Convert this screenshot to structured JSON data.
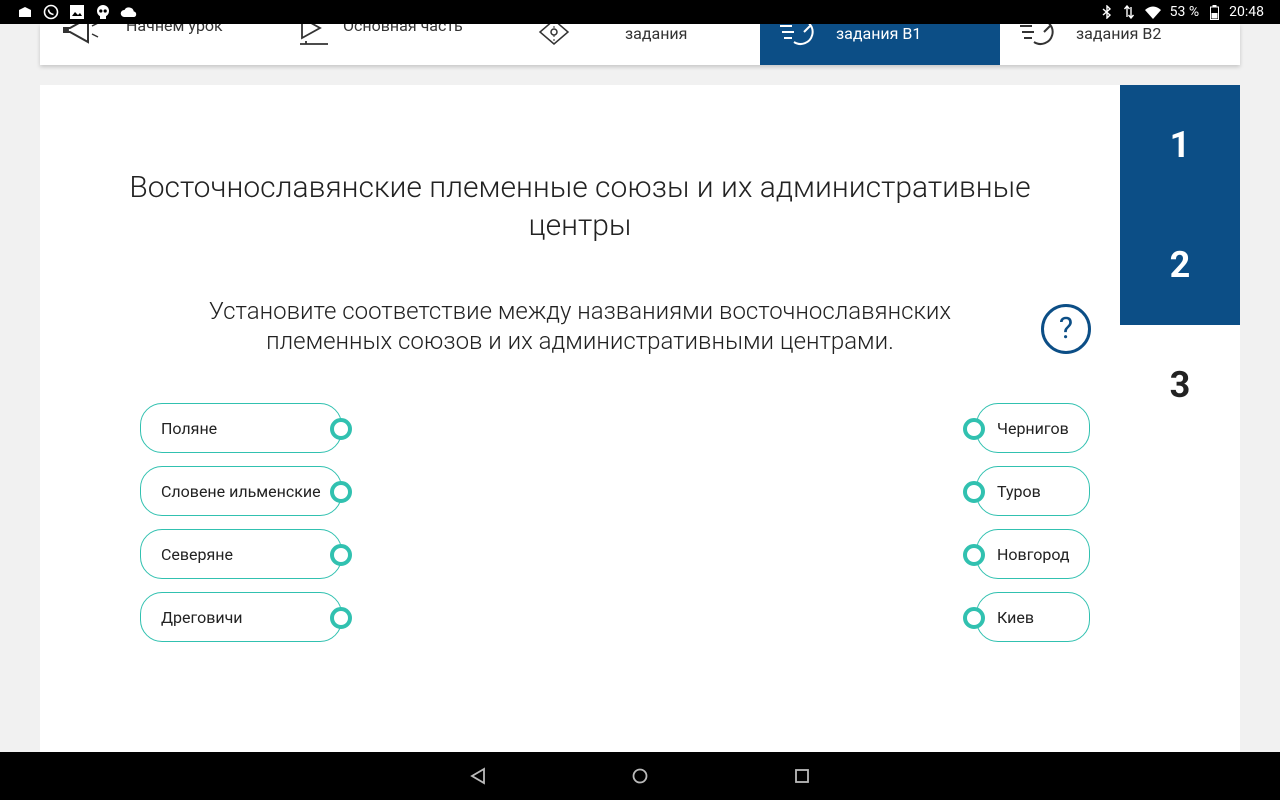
{
  "status_bar": {
    "battery": "53 %",
    "time": "20:48",
    "left_icons": [
      "notification-icon",
      "whatsapp-icon",
      "image-icon",
      "skull-icon",
      "cloud-icon"
    ],
    "right_icons": [
      "bluetooth-icon",
      "data-icon",
      "wifi-icon",
      "battery-icon"
    ]
  },
  "tabs": [
    {
      "label": "Начнем урок",
      "icon": "megaphone-icon",
      "active": false
    },
    {
      "label": "Основная часть",
      "icon": "pen-icon",
      "active": false
    },
    {
      "label": "задания",
      "icon": "target-icon",
      "active": false
    },
    {
      "label": "задания В1",
      "icon": "speed-icon",
      "active": true
    },
    {
      "label": "задания В2",
      "icon": "speed-icon",
      "active": false
    }
  ],
  "main": {
    "title": "Восточнославянские племенные союзы и их административные центры",
    "instruction": "Установите соответствие между названиями восточнославянских племенных союзов и их административными центрами.",
    "help_symbol": "?"
  },
  "question_nav": [
    {
      "label": "1",
      "state": "done"
    },
    {
      "label": "2",
      "state": "done"
    },
    {
      "label": "3",
      "state": "current"
    }
  ],
  "left_items": [
    "Поляне",
    "Словене ильменские",
    "Северяне",
    "Дреговичи"
  ],
  "right_items": [
    "Чернигов",
    "Туров",
    "Новгород",
    "Киев"
  ],
  "colors": {
    "primary": "#0c4e86",
    "accent": "#31c1b0",
    "background": "#f1f1f1"
  },
  "nav_bar": [
    "back-icon",
    "home-icon",
    "recents-icon"
  ]
}
